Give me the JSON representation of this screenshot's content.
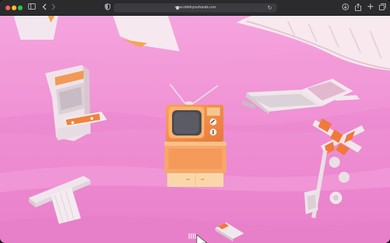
{
  "browser": {
    "url": "www.orbitinyourhands.com",
    "icons": {
      "sidebar": "sidebar-icon",
      "back": "chevron-left-icon",
      "forward": "chevron-right-icon",
      "shield": "shield-icon",
      "lock": "lock-icon",
      "reload": "reload-icon",
      "downloads": "download-icon",
      "share": "share-icon",
      "new_tab": "plus-icon",
      "tabs": "tabs-overview-icon"
    }
  },
  "scene": {
    "background_color": "#f08fd4",
    "objects": [
      "arcade-cabinet",
      "retro-tv",
      "laptop",
      "railroad-crossing-sign",
      "column-pedestal",
      "cassette-tape"
    ],
    "cursor": "hand-pointer"
  }
}
